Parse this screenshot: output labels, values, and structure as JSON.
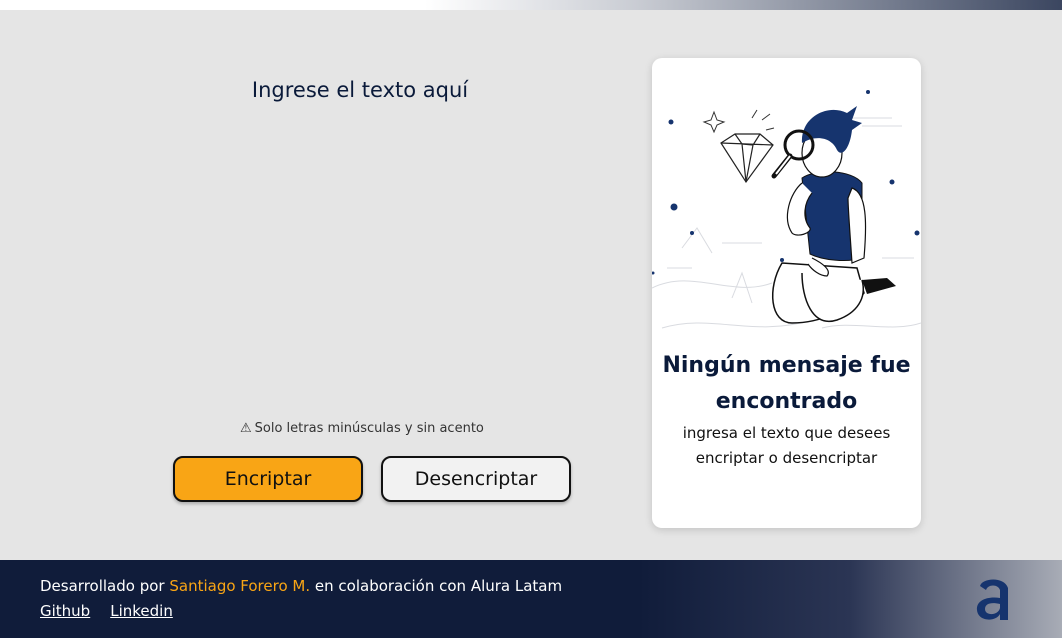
{
  "input": {
    "placeholder": "Ingrese el texto aquí",
    "value": ""
  },
  "warning": {
    "icon": "warning-icon",
    "text": "Solo letras minúsculas y sin acento"
  },
  "buttons": {
    "encrypt_label": "Encriptar",
    "decrypt_label": "Desencriptar"
  },
  "result_card": {
    "title": "Ningún mensaje fue encontrado",
    "subtitle": "ingresa el texto que desees encriptar o desencriptar"
  },
  "footer": {
    "prefix": "Desarrollado por",
    "author": "Santiago Forero M.",
    "suffix": "en colaboración con Alura Latam",
    "links": [
      "Github",
      "Linkedin"
    ],
    "logo_icon": "alura-logo-icon"
  },
  "colors": {
    "background": "#e5e5e5",
    "accent": "#f9a515",
    "primary": "#0a1a3a",
    "footer": "#101c3a"
  }
}
